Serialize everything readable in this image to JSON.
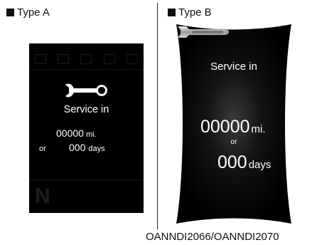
{
  "type_a": {
    "label": "Type A",
    "service_text": "Service in",
    "miles_value": "00000",
    "miles_unit": "mi.",
    "or_text": "or",
    "days_value": "000",
    "days_unit": "days",
    "wrench_icon": "wrench-icon",
    "background_color": "#000000",
    "text_color": "#ffffff"
  },
  "type_b": {
    "label": "Type B",
    "service_text": "Service in",
    "miles_value": "00000",
    "miles_unit": "mi.",
    "or_text": "or",
    "days_value": "000",
    "days_unit": "days",
    "wrench_icon": "wrench-icon",
    "background_color": "#000000",
    "text_color": "#ffffff"
  },
  "caption": "OANNDI2066/OANNDI2070"
}
